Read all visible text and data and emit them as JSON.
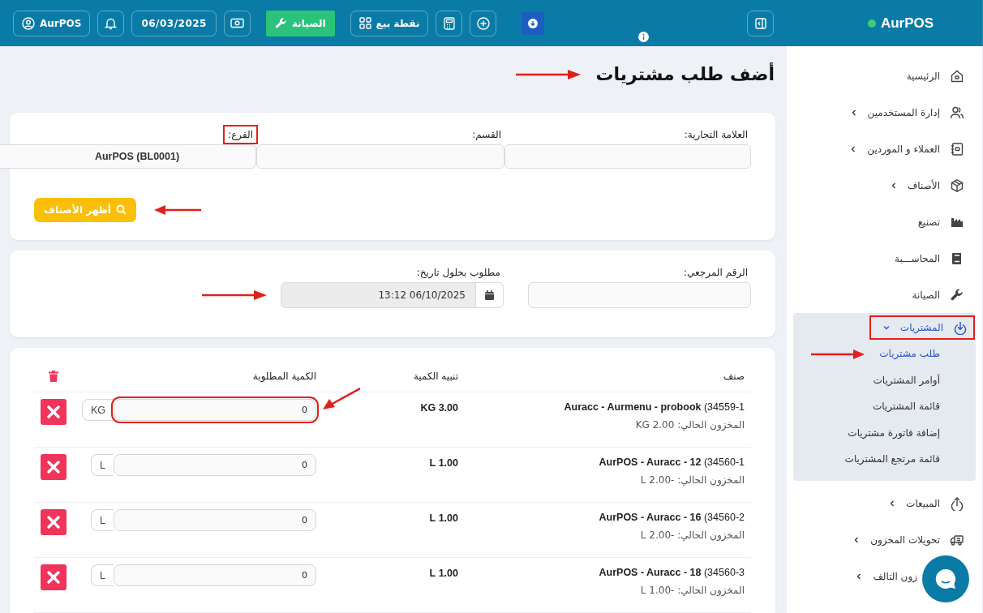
{
  "sidebar": {
    "brand": "AurPOS",
    "items": [
      {
        "label": "الرئيسية",
        "expandable": false,
        "selected": false,
        "marked": false
      },
      {
        "label": "إدارة المستخدمين",
        "expandable": true,
        "expanded": false,
        "selected": false,
        "marked": false
      },
      {
        "label": "العملاء و الموردين",
        "expandable": true,
        "expanded": false,
        "selected": false,
        "marked": false
      },
      {
        "label": "الأصناف",
        "expandable": true,
        "expanded": false,
        "selected": false,
        "marked": false
      },
      {
        "label": "تصنيع",
        "expandable": false,
        "selected": false,
        "marked": false
      },
      {
        "label": "المحاســـبة",
        "expandable": false,
        "selected": false,
        "marked": false
      },
      {
        "label": "الصيانة",
        "expandable": false,
        "selected": false,
        "marked": false
      },
      {
        "label": "المشتريات",
        "expandable": true,
        "expanded": true,
        "selected": true,
        "marked": true,
        "children": [
          {
            "label": "طلب مشتريات",
            "selected": true,
            "pointer": true
          },
          {
            "label": "أوامر المشتريات",
            "selected": false,
            "pointer": false
          },
          {
            "label": "قائمة المشتريات",
            "selected": false,
            "pointer": false
          },
          {
            "label": "إضافة فاتورة مشتريات",
            "selected": false,
            "pointer": false
          },
          {
            "label": "قائمة مرتجع المشتريات",
            "selected": false,
            "pointer": false
          }
        ]
      },
      {
        "label": "المبيعات",
        "expandable": true,
        "expanded": false,
        "selected": false,
        "marked": false
      },
      {
        "label": "تحويلات المخزون",
        "expandable": true,
        "expanded": false,
        "selected": false,
        "marked": false
      },
      {
        "label": "زون التالف",
        "expandable": true,
        "expanded": false,
        "selected": false,
        "marked": false
      }
    ]
  },
  "topbar": {
    "buttons": [
      {
        "kind": "download"
      },
      {
        "kind": "add"
      },
      {
        "kind": "calculator"
      },
      {
        "kind": "pos",
        "label": "نقطة بيع"
      },
      {
        "kind": "maintenance",
        "label": "الصيانة"
      },
      {
        "kind": "cash"
      },
      {
        "kind": "date",
        "label": "06/03/2025"
      },
      {
        "kind": "bell"
      },
      {
        "kind": "user",
        "label": "AurPOS"
      }
    ]
  },
  "page": {
    "title": "أضف طلب مشتريات",
    "pointer": true
  },
  "filters": {
    "fields": [
      {
        "label": "العلامة التجارية:",
        "highlighted": false
      },
      {
        "label": "القسم:",
        "highlighted": false
      },
      {
        "label": "الفرع:",
        "value": "AurPOS (BL0001)",
        "highlighted": true
      }
    ],
    "button": {
      "label": "أظهر الأصناف",
      "pointer": true
    }
  },
  "details": {
    "fields": [
      {
        "label": "الرقم المرجعي:",
        "kind": "text",
        "pointer": false
      },
      {
        "label": "مطلوب بحلول تاريخ:",
        "kind": "date",
        "value": "13:12 06/10/2025",
        "pointer": true
      }
    ]
  },
  "table": {
    "columns": [
      "صنف",
      "تنبيه الكمية",
      "الكمية المطلوبة"
    ],
    "rows": [
      {
        "item": "**Auracc - Aurmenu - probook** (34559-1",
        "stock": "المخزون الحالي: 2.00 KG",
        "alert": "3.00 KG",
        "quantity": "0",
        "unit": "KG",
        "marked": true
      },
      {
        "item": "**AurPOS - Auracc - 12** (34560-1",
        "stock": "المخزون الحالي: -2.00 L",
        "alert": "1.00 L",
        "quantity": "0",
        "unit": "L",
        "marked": false
      },
      {
        "item": "**AurPOS - Auracc - 16** (34560-2",
        "stock": "المخزون الحالي: -2.00 L",
        "alert": "1.00 L",
        "quantity": "0",
        "unit": "L",
        "marked": false
      },
      {
        "item": "**AurPOS - Auracc - 18** (34560-3",
        "stock": "المخزون الحالي: -1.00 L",
        "alert": "1.00 L",
        "quantity": "0",
        "unit": "L",
        "marked": false
      }
    ]
  }
}
